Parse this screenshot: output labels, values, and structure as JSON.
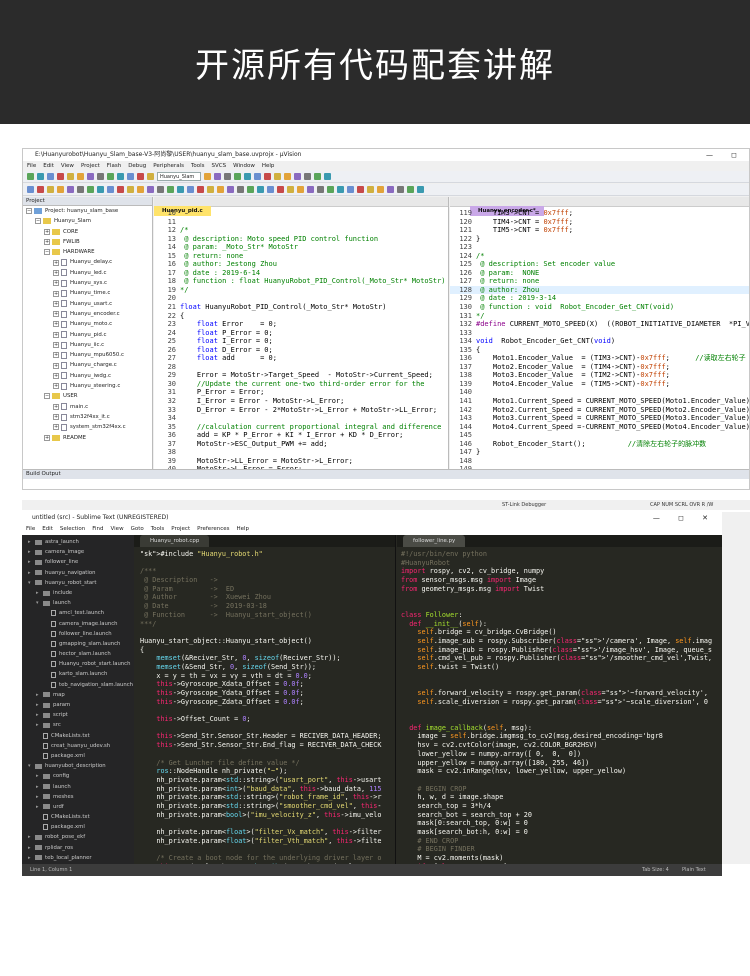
{
  "banner": {
    "title": "开源所有代码配套讲解"
  },
  "uvision": {
    "title": "E:\\Huanyurobot\\Huanyu_Slam_base-V3-阿尚黎\\USER\\huanyu_slam_base.uvprojx - µVision",
    "menu": [
      "File",
      "Edit",
      "View",
      "Project",
      "Flash",
      "Debug",
      "Peripherals",
      "Tools",
      "SVCS",
      "Window",
      "Help"
    ],
    "target": "Huanyu_Slam",
    "project_header": "Project",
    "tree": [
      {
        "t": "Project: huanyu_slam_base",
        "d": 0,
        "k": "root"
      },
      {
        "t": "Huanyu_Slam",
        "d": 1,
        "k": "fo"
      },
      {
        "t": "CORE",
        "d": 2,
        "k": "fo"
      },
      {
        "t": "FWLIB",
        "d": 2,
        "k": "fo"
      },
      {
        "t": "HARDWARE",
        "d": 2,
        "k": "fo"
      },
      {
        "t": "Huanyu_delay.c",
        "d": 3,
        "k": "fi"
      },
      {
        "t": "Huanyu_led.c",
        "d": 3,
        "k": "fi"
      },
      {
        "t": "Huanyu_sys.c",
        "d": 3,
        "k": "fi"
      },
      {
        "t": "Huanyu_time.c",
        "d": 3,
        "k": "fi"
      },
      {
        "t": "Huanyu_usart.c",
        "d": 3,
        "k": "fi"
      },
      {
        "t": "Huanyu_encoder.c",
        "d": 3,
        "k": "fi"
      },
      {
        "t": "Huanyu_moto.c",
        "d": 3,
        "k": "fi"
      },
      {
        "t": "Huanyu_pid.c",
        "d": 3,
        "k": "fi"
      },
      {
        "t": "Huanyu_iic.c",
        "d": 3,
        "k": "fi"
      },
      {
        "t": "Huanyu_mpu6050.c",
        "d": 3,
        "k": "fi"
      },
      {
        "t": "Huanyu_charge.c",
        "d": 3,
        "k": "fi"
      },
      {
        "t": "Huanyu_iwdg.c",
        "d": 3,
        "k": "fi"
      },
      {
        "t": "Huanyu_steering.c",
        "d": 3,
        "k": "fi"
      },
      {
        "t": "USER",
        "d": 2,
        "k": "fo"
      },
      {
        "t": "main.c",
        "d": 3,
        "k": "fi"
      },
      {
        "t": "stm32f4xx_it.c",
        "d": 3,
        "k": "fi"
      },
      {
        "t": "system_stm32f4xx.c",
        "d": 3,
        "k": "fi"
      },
      {
        "t": "README",
        "d": 2,
        "k": "fo"
      }
    ],
    "tab_left": "Huanyu_pid.c",
    "tab_right": "Huanyu_encoder.c*",
    "build_output": "Build Output",
    "status_left": "ST-Link Debugger",
    "status_right": "CAP  NUM  SCRL  OVR  R /W",
    "left_lines": [
      [
        "10",
        ""
      ],
      [
        "11",
        ""
      ],
      [
        "12",
        "/*"
      ],
      [
        "13",
        " @ description: Moto speed PID control function"
      ],
      [
        "14",
        " @ param: _Moto_Str* MotoStr"
      ],
      [
        "15",
        " @ return: none"
      ],
      [
        "16",
        " @ author: Jestong Zhou"
      ],
      [
        "17",
        " @ date : 2019-6-14"
      ],
      [
        "18",
        " @ function : float HuanyuRobot_PID_Control(_Moto_Str* MotoStr)"
      ],
      [
        "19",
        "*/"
      ],
      [
        "20",
        ""
      ],
      [
        "21",
        "float HuanyuRobot_PID_Control(_Moto_Str* MotoStr)"
      ],
      [
        "22",
        "{"
      ],
      [
        "23",
        "    float Error    = 0;"
      ],
      [
        "24",
        "    float P_Error = 0;"
      ],
      [
        "25",
        "    float I_Error = 0;"
      ],
      [
        "26",
        "    float D_Error = 0;"
      ],
      [
        "27",
        "    float add      = 0;"
      ],
      [
        "28",
        ""
      ],
      [
        "29",
        "    Error = MotoStr->Target_Speed  - MotoStr->Current_Speed;"
      ],
      [
        "30",
        "    //Update the current one-two third-order error for the"
      ],
      [
        "31",
        "    P_Error = Error;"
      ],
      [
        "32",
        "    I_Error = Error - MotoStr->L_Error;"
      ],
      [
        "33",
        "    D_Error = Error - 2*MotoStr->L_Error + MotoStr->LL_Error;"
      ],
      [
        "34",
        ""
      ],
      [
        "35",
        "    //calculation current proportional integral and difference"
      ],
      [
        "36",
        "    add = KP * P_Error + KI * I_Error + KD * D_Error;"
      ],
      [
        "37",
        "    MotoStr->ESC_Output_PWM += add;"
      ],
      [
        "38",
        ""
      ],
      [
        "39",
        "    MotoStr->LL_Error = MotoStr->L_Error;"
      ],
      [
        "40",
        "    MotoStr->L_Error = Error;"
      ],
      [
        "41",
        ""
      ]
    ],
    "right_lines": [
      [
        "119",
        "    TIM3->CNT = 0x7fff;"
      ],
      [
        "120",
        "    TIM4->CNT = 0x7fff;"
      ],
      [
        "121",
        "    TIM5->CNT = 0x7fff;"
      ],
      [
        "122",
        "}"
      ],
      [
        "123",
        ""
      ],
      [
        "124",
        "/*"
      ],
      [
        "125",
        " @ description: Set encoder value"
      ],
      [
        "126",
        " @ param:  NONE"
      ],
      [
        "127",
        " @ return: none"
      ],
      [
        "128",
        " @ author: Zhou"
      ],
      [
        "129",
        " @ date : 2019-3-14"
      ],
      [
        "130",
        " @ function : void  Robot_Encoder_Get_CNT(void)"
      ],
      [
        "131",
        "*/"
      ],
      [
        "132",
        "#define CURRENT_MOTO_SPEED(X)  ((ROBOT_INITIATIVE_DIAMETER  *PI_V"
      ],
      [
        "133",
        ""
      ],
      [
        "134",
        "void  Robot_Encoder_Get_CNT(void)"
      ],
      [
        "135",
        "{"
      ],
      [
        "136",
        "    Moto1.Encoder_Value  = (TIM3->CNT)-0x7fff;      //读取左右轮子"
      ],
      [
        "137",
        "    Moto2.Encoder_Value  = (TIM4->CNT)-0x7fff;"
      ],
      [
        "138",
        "    Moto3.Encoder_Value  = (TIM2->CNT)-0x7fff;"
      ],
      [
        "139",
        "    Moto4.Encoder_Value  = (TIM5->CNT)-0x7fff;"
      ],
      [
        "140",
        ""
      ],
      [
        "141",
        "    Moto1.Current_Speed = CURRENT_MOTO_SPEED(Moto1.Encoder_Value);"
      ],
      [
        "142",
        "    Moto2.Current_Speed = CURRENT_MOTO_SPEED(Moto2.Encoder_Value);"
      ],
      [
        "143",
        "    Moto3.Current_Speed = CURRENT_MOTO_SPEED(Moto3.Encoder_Value);"
      ],
      [
        "144",
        "    Moto4.Current_Speed =-CURRENT_MOTO_SPEED(Moto4.Encoder_Value)"
      ],
      [
        "145",
        ""
      ],
      [
        "146",
        "    Robot_Encoder_Start();          //清除左右轮子的脉冲数"
      ],
      [
        "147",
        "}"
      ],
      [
        "148",
        ""
      ],
      [
        "149",
        ""
      ],
      [
        "150",
        ""
      ]
    ]
  },
  "sublime": {
    "title": "untitled (src) - Sublime Text (UNREGISTERED)",
    "menu": [
      "File",
      "Edit",
      "Selection",
      "Find",
      "View",
      "Goto",
      "Tools",
      "Project",
      "Preferences",
      "Help"
    ],
    "tab_left": "Huanyu_robot.cpp",
    "tab_right": "follower_line.py",
    "sidebar": [
      {
        "t": "astra_launch",
        "d": 0,
        "k": "f"
      },
      {
        "t": "camera_image",
        "d": 0,
        "k": "f"
      },
      {
        "t": "follower_line",
        "d": 0,
        "k": "f"
      },
      {
        "t": "huanyu_navigation",
        "d": 0,
        "k": "f"
      },
      {
        "t": "huanyu_robot_start",
        "d": 0,
        "k": "o"
      },
      {
        "t": "include",
        "d": 1,
        "k": "f"
      },
      {
        "t": "launch",
        "d": 1,
        "k": "o"
      },
      {
        "t": "amcl_test.launch",
        "d": 2,
        "k": "d"
      },
      {
        "t": "camera_image.launch",
        "d": 2,
        "k": "d"
      },
      {
        "t": "follower_line.launch",
        "d": 2,
        "k": "d"
      },
      {
        "t": "gmapping_slam.launch",
        "d": 2,
        "k": "d"
      },
      {
        "t": "hector_slam.launch",
        "d": 2,
        "k": "d"
      },
      {
        "t": "Huanyu_robot_start.launch",
        "d": 2,
        "k": "d"
      },
      {
        "t": "karto_slam.launch",
        "d": 2,
        "k": "d"
      },
      {
        "t": "teb_navigation_slam.launch",
        "d": 2,
        "k": "d"
      },
      {
        "t": "map",
        "d": 1,
        "k": "f"
      },
      {
        "t": "param",
        "d": 1,
        "k": "f"
      },
      {
        "t": "script",
        "d": 1,
        "k": "f"
      },
      {
        "t": "src",
        "d": 1,
        "k": "f"
      },
      {
        "t": "CMakeLists.txt",
        "d": 1,
        "k": "d"
      },
      {
        "t": "creat_huanyu_udev.sh",
        "d": 1,
        "k": "d"
      },
      {
        "t": "package.xml",
        "d": 1,
        "k": "d"
      },
      {
        "t": "huanyubot_description",
        "d": 0,
        "k": "o"
      },
      {
        "t": "config",
        "d": 1,
        "k": "f"
      },
      {
        "t": "launch",
        "d": 1,
        "k": "f"
      },
      {
        "t": "meshes",
        "d": 1,
        "k": "f"
      },
      {
        "t": "urdf",
        "d": 1,
        "k": "f"
      },
      {
        "t": "CMakeLists.txt",
        "d": 1,
        "k": "d"
      },
      {
        "t": "package.xml",
        "d": 1,
        "k": "d"
      },
      {
        "t": "robot_pose_ekf",
        "d": 0,
        "k": "f"
      },
      {
        "t": "rplidar_ros",
        "d": 0,
        "k": "f"
      },
      {
        "t": "teb_local_planner",
        "d": 0,
        "k": "f"
      },
      {
        "t": "track_detection",
        "d": 0,
        "k": "f"
      },
      {
        "t": "CMakeLists.txt",
        "d": 0,
        "k": "d"
      }
    ],
    "status_left": "Line 1, Column 1",
    "status_mid": "Tab Size: 4",
    "status_right": "Plain Text",
    "cpp_lines": [
      "#include \"Huanyu_robot.h\"",
      "",
      "/***",
      " @ Description   ->",
      " @ Param         ->  ED",
      " @ Author        ->  Xuewei Zhou",
      " @ Date          ->  2019-03-18",
      " @ Function      ->  Huanyu_start_object()",
      "***/",
      "",
      "Huanyu_start_object::Huanyu_start_object()",
      "{",
      "    memset(&Reciver_Str, 0, sizeof(Reciver_Str));",
      "    memset(&Send_Str, 0, sizeof(Send_Str));",
      "    x = y = th = vx = vy = vth = dt = 0.0;",
      "    this->Gyroscope_Xdata_Offset = 0.0f;",
      "    this->Gyroscope_Ydata_Offset = 0.0f;",
      "    this->Gyroscope_Zdata_Offset = 0.0f;",
      "",
      "    this->Offset_Count = 0;",
      "",
      "    this->Send_Str.Sensor_Str.Header = RECIVER_DATA_HEADER;",
      "    this->Send_Str.Sensor_Str.End_flag = RECIVER_DATA_CHECK",
      "",
      "    /* Get Luncher file define value */",
      "    ros::NodeHandle nh_private(\"~\");",
      "    nh_private.param<std::string>(\"usart_port\", this->usart",
      "    nh_private.param<int>(\"baud_data\", this->baud_data, 115",
      "    nh_private.param<std::string>(\"robot_frame_id\", this->r",
      "    nh_private.param<std::string>(\"smoother_cmd_vel\", this-",
      "    nh_private.param<bool>(\"imu_velocity_z\", this->imu_velo",
      "",
      "    nh_private.param<float>(\"filter_Vx_match\", this->filter",
      "    nh_private.param<float>(\"filter_Vth_match\", this->filte",
      "",
      "    /* Create a boot node for the underlying driver layer o",
      "    this->cmd_vel_sub = n.subscribe(smoother_cmd_vel, 100,"
    ],
    "py_lines": [
      "#!/usr/bin/env python",
      "#HuanyuRobot",
      "import rospy, cv2, cv_bridge, numpy",
      "from sensor_msgs.msg import Image",
      "from geometry_msgs.msg import Twist",
      "",
      "",
      "class Follower:",
      "  def __init__(self):",
      "    self.bridge = cv_bridge.CvBridge()",
      "    self.image_sub = rospy.Subscriber('/camera', Image, self.imag",
      "    self.image_pub = rospy.Publisher('/image_hsv', Image, queue_s",
      "    self.cmd_vel_pub = rospy.Publisher('/smoother_cmd_vel',Twist,",
      "    self.twist = Twist()",
      "",
      "",
      "    self.forward_velocity = rospy.get_param('~forward_velocity', ",
      "    self.scale_diversion = rospy.get_param('~scale_diversion', 0",
      "",
      "",
      "  def image_callback(self, msg):",
      "    image = self.bridge.imgmsg_to_cv2(msg,desired_encoding='bgr8",
      "    hsv = cv2.cvtColor(image, cv2.COLOR_BGR2HSV)",
      "    lower_yellow = numpy.array([ 0,  0,  0])",
      "    upper_yellow = numpy.array([180, 255, 46])",
      "    mask = cv2.inRange(hsv, lower_yellow, upper_yellow)",
      "",
      "    # BEGIN CROP",
      "    h, w, d = image.shape",
      "    search_top = 3*h/4",
      "    search_bot = search_top + 20",
      "    mask[0:search_top, 0:w] = 0",
      "    mask[search_bot:h, 0:w] = 0",
      "    # END CROP",
      "    # BEGIN FINDER",
      "    M = cv2.moments(mask)",
      "    if M['m00'] > 0:",
      "      cx = int(M['m10']/M['m00'])"
    ]
  }
}
